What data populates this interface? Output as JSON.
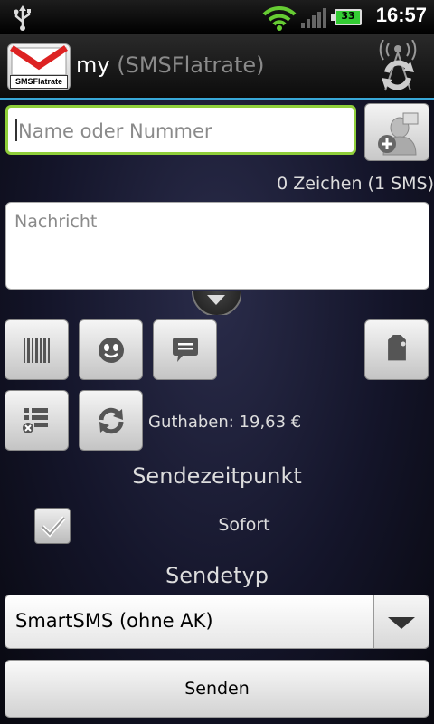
{
  "status_bar": {
    "time": "16:57",
    "battery": "33",
    "icons": [
      "usb-icon",
      "wifi-icon",
      "signal-icon",
      "battery-icon"
    ]
  },
  "header": {
    "logo_text": "SMSFlatrate",
    "title_main": "my",
    "title_sub": "(SMSFlatrate)",
    "accent_color": "#38a8d8"
  },
  "form": {
    "recipient_placeholder": "Name oder Nummer",
    "char_count": "0 Zeichen (1 SMS)",
    "message_placeholder": "Nachricht",
    "balance": "Guthaben: 19,63 €",
    "send_time_label": "Sendezeitpunkt",
    "send_time_option": "Sofort",
    "send_type_label": "Sendetyp",
    "send_type_value": "SmartSMS (ohne AK)",
    "send_button": "Senden"
  },
  "toolbar": {
    "icons": [
      "barcode-icon",
      "smiley-icon",
      "template-icon",
      "tag-icon",
      "list-icon",
      "refresh-icon"
    ]
  },
  "colors": {
    "focus_border": "#8fce3a",
    "accent": "#38a8d8"
  }
}
